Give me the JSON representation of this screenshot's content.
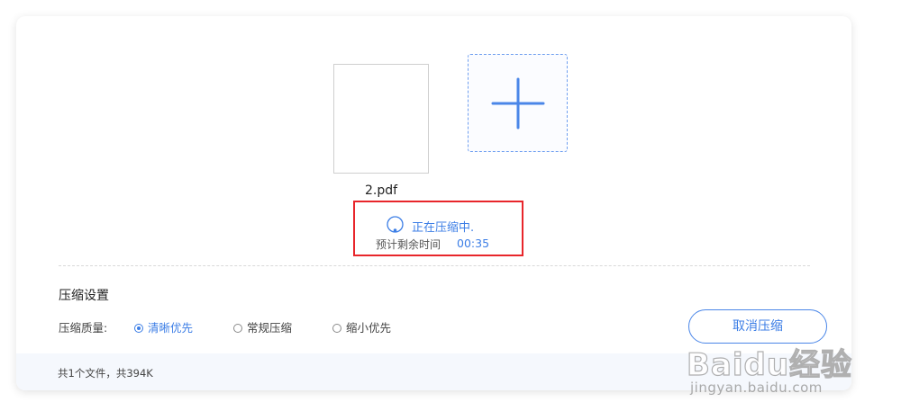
{
  "file": {
    "name": "2.pdf"
  },
  "progress": {
    "status_text": "正在压缩中.",
    "eta_label": "预计剩余时间",
    "eta_value": "00:35"
  },
  "settings": {
    "title": "压缩设置",
    "quality_label": "压缩质量:",
    "options": [
      {
        "label": "清晰优先",
        "checked": true
      },
      {
        "label": "常规压缩",
        "checked": false
      },
      {
        "label": "缩小优先",
        "checked": false
      }
    ],
    "cancel_label": "取消压缩"
  },
  "footer": {
    "summary": "共1个文件，共394K"
  },
  "watermark": {
    "logo_text": "Baidu经验",
    "url": "jingyan.baidu.com"
  },
  "colors": {
    "accent": "#3c7ee6",
    "highlight_border": "#e8262b"
  }
}
